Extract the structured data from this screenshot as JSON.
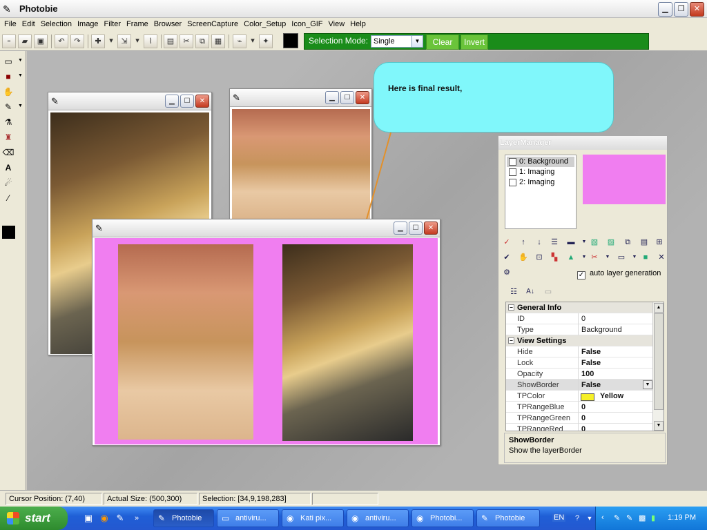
{
  "app": {
    "title": "Photobie"
  },
  "menu": [
    "File",
    "Edit",
    "Selection",
    "Image",
    "Filter",
    "Frame",
    "Browser",
    "ScreenCapture",
    "Color_Setup",
    "Icon_GIF",
    "View",
    "Help"
  ],
  "selection_panel": {
    "label": "Selection Mode:",
    "mode": "Single",
    "clear": "Clear",
    "invert": "Invert"
  },
  "colors": {
    "accent_green": "#1a8c1a",
    "callout": "#80f7fb",
    "layer_bg": "#f07ef0",
    "tp_color": "#f6f028"
  },
  "callout": {
    "text": "Here is final result,"
  },
  "layer_manager": {
    "title": "LayerManager",
    "layers": [
      {
        "name": "0: Background",
        "selected": true
      },
      {
        "name": "1: Imaging",
        "selected": false
      },
      {
        "name": "2: Imaging",
        "selected": false
      }
    ],
    "auto_layer": "auto layer generation",
    "properties": {
      "general": "General Info",
      "id_k": "ID",
      "id_v": "0",
      "type_k": "Type",
      "type_v": "Background",
      "view": "View Settings",
      "hide_k": "Hide",
      "hide_v": "False",
      "lock_k": "Lock",
      "lock_v": "False",
      "opacity_k": "Opacity",
      "opacity_v": "100",
      "showborder_k": "ShowBorder",
      "showborder_v": "False",
      "tpcolor_k": "TPColor",
      "tpcolor_v": "Yellow",
      "blue_k": "TPRangeBlue",
      "blue_v": "0",
      "green_k": "TPRangeGreen",
      "green_v": "0",
      "red_k": "TPRangeRed",
      "red_v": "0"
    },
    "desc_title": "ShowBorder",
    "desc_text": "Show the layerBorder"
  },
  "status": {
    "cursor": "Cursor Position: (7,40)",
    "size": "Actual Size: (500,300)",
    "selection": "Selection: [34,9,198,283]"
  },
  "taskbar": {
    "start": "start",
    "tasks": [
      "Photobie",
      "antiviru...",
      "Kati pix...",
      "antiviru...",
      "Photobi...",
      "Photobie"
    ],
    "lang": "EN",
    "clock": "1:19 PM"
  }
}
